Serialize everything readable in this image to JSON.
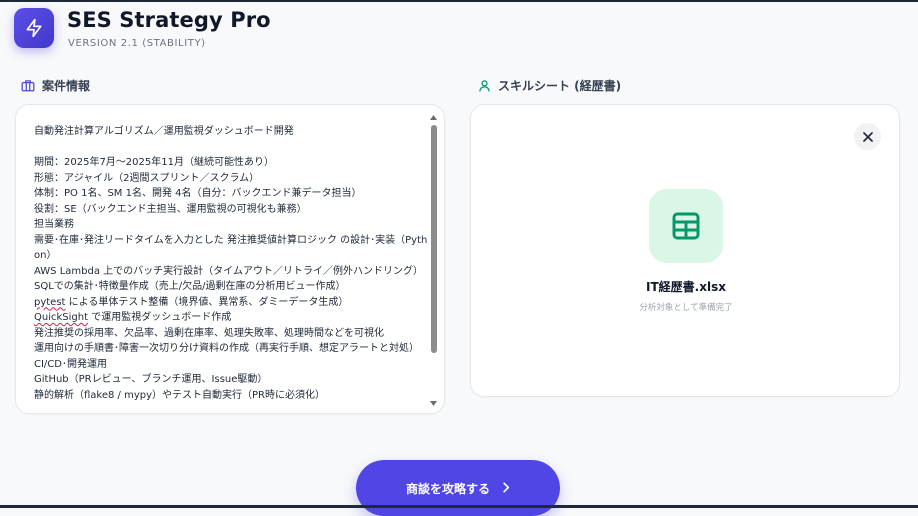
{
  "header": {
    "title": "SES Strategy Pro",
    "version": "VERSION 2.1 (STABILITY)"
  },
  "project_section": {
    "label": "案件情報",
    "icon": "briefcase-icon",
    "lines": [
      "自動発注計算アルゴリズム／運用監視ダッシュボード開発",
      "",
      "期間：2025年7月～2025年11月（継続可能性あり）",
      "形態：アジャイル（2週間スプリント／スクラム）",
      "体制：PO 1名、SM 1名、開発 4名（自分：バックエンド兼データ担当）",
      "役割：SE（バックエンド主担当、運用監視の可視化も兼務）",
      "担当業務",
      "需要･在庫･発注リードタイムを入力とした 発注推奨値計算ロジック の設計･実装（Python）",
      "AWS Lambda 上でのバッチ実行設計（タイムアウト／リトライ／例外ハンドリング）",
      "SQLでの集計･特徴量作成（売上/欠品/過剰在庫の分析用ビュー作成）",
      "pytest による単体テスト整備（境界値、異常系、ダミーデータ生成）",
      "QuickSight で運用監視ダッシュボード作成",
      "発注推奨の採用率、欠品率、過剰在庫率、処理失敗率、処理時間などを可視化",
      "運用向けの手順書･障害一次切り分け資料の作成（再実行手順、想定アラートと対処）",
      "CI/CD･開発運用",
      "GitHub（PRレビュー、ブランチ運用、Issue駆動）",
      "静的解析（flake8 / mypy）やテスト自動実行（PR時に必須化）"
    ]
  },
  "skill_section": {
    "label": "スキルシート (経歴書)",
    "icon": "user-icon",
    "file_name": "IT経歴書.xlsx",
    "file_status": "分析対象として準備完了",
    "file_icon": "spreadsheet-icon"
  },
  "cta": {
    "label": "商談を攻略する"
  },
  "colors": {
    "accent": "#4f46e5",
    "success": "#059669",
    "file_icon_bg": "#d9f6e7"
  }
}
